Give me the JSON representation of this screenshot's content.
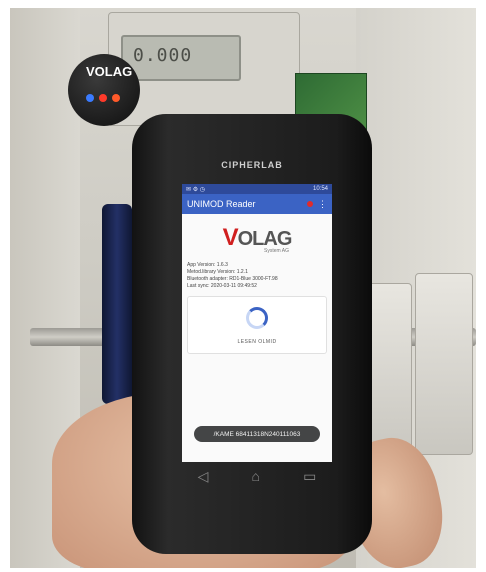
{
  "device": {
    "brand_label": "CIPHERLAB"
  },
  "probe": {
    "logo_text": "VOLAG",
    "led_colors": [
      "#3a7bff",
      "#ff3a2a",
      "#ff5a2a"
    ]
  },
  "meter": {
    "lcd_text": "0.000"
  },
  "status_bar": {
    "time": "10:54"
  },
  "app": {
    "title": "UNIMOD Reader",
    "logo_letter": "V",
    "logo_rest": "OLAG",
    "logo_sub": "System AG",
    "info_lines": [
      "App Version: 1.6.3",
      "Metod.library Version: 1.2.1",
      "Bluetooth adapter: RD1-Blue 3000-FT.98",
      "Last sync: 2020-03-11 09:49:52"
    ],
    "read_label": "LESEN OLMID",
    "toast": "/KAME 68411318N240111063",
    "accent_color": "#3b63c4",
    "record_color": "#e12b2b"
  },
  "nav": {
    "back_icon": "back-arrow-icon",
    "home_icon": "home-icon",
    "recents_icon": "recents-icon"
  }
}
